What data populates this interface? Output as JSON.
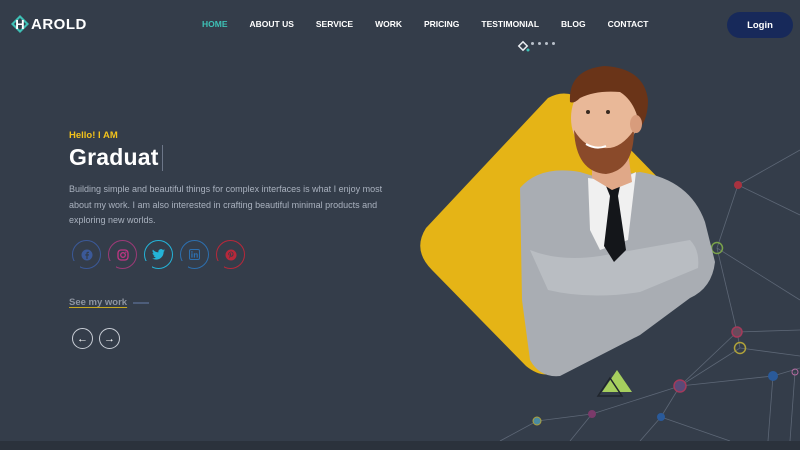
{
  "brand": {
    "mark_letter": "H",
    "name": "AROLD",
    "accent": "#3ec1b6"
  },
  "nav": {
    "items": [
      {
        "label": "HOME",
        "active": true
      },
      {
        "label": "ABOUT US",
        "active": false
      },
      {
        "label": "SERVICE",
        "active": false
      },
      {
        "label": "WORK",
        "active": false
      },
      {
        "label": "PRICING",
        "active": false
      },
      {
        "label": "TESTIMONIAL",
        "active": false
      },
      {
        "label": "BLOG",
        "active": false
      },
      {
        "label": "CONTACT",
        "active": false
      }
    ]
  },
  "login": {
    "label": "Login",
    "color": "#17295a"
  },
  "hero": {
    "greeting": "Hello! I AM",
    "headline": "Graduat",
    "description": "Building simple and beautiful things for complex interfaces is what I enjoy most about my work. I am also interested in crafting beautiful minimal products and exploring new worlds.",
    "socials": [
      {
        "icon": "facebook-icon",
        "color": "#3b5998"
      },
      {
        "icon": "instagram-icon",
        "color": "#9c3a77"
      },
      {
        "icon": "twitter-icon",
        "color": "#24b3d8"
      },
      {
        "icon": "linkedin-icon",
        "color": "#2d6fae"
      },
      {
        "icon": "pinterest-icon",
        "color": "#b7283a"
      }
    ],
    "cta": "See my work",
    "prev_icon": "←",
    "next_icon": "→"
  },
  "colors": {
    "background": "#343d4a",
    "yellow": "#e5b416",
    "greeting": "#f2c21b"
  }
}
